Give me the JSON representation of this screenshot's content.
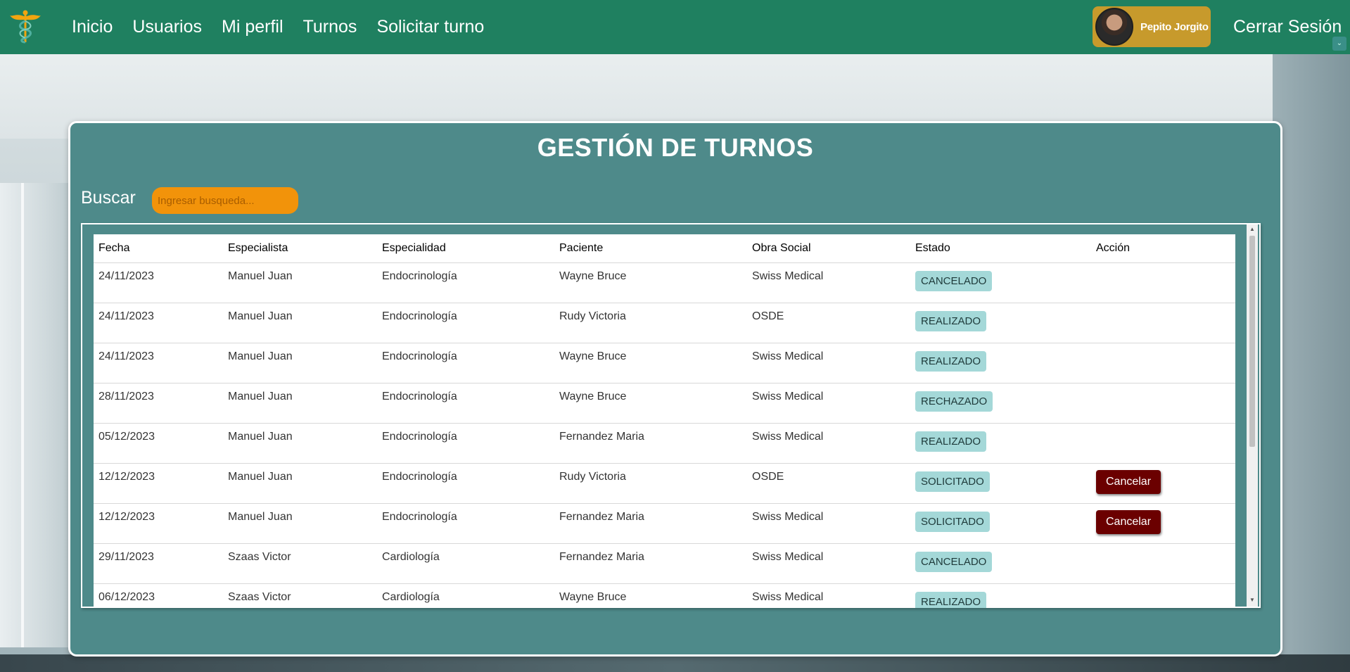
{
  "nav": {
    "links": [
      "Inicio",
      "Usuarios",
      "Mi perfil",
      "Turnos",
      "Solicitar turno"
    ],
    "user_name": "Pepito Jorgito",
    "logout_label": "Cerrar Sesión",
    "brand_color": "#1f8060"
  },
  "panel": {
    "title": "GESTIÓN DE TURNOS",
    "search_label": "Buscar",
    "search_placeholder": "Ingresar busqueda...",
    "search_value": ""
  },
  "table": {
    "headers": [
      "Fecha",
      "Especialista",
      "Especialidad",
      "Paciente",
      "Obra Social",
      "Estado",
      "Acción"
    ],
    "rows": [
      {
        "fecha": "24/11/2023",
        "especialista": "Manuel Juan",
        "especialidad": "Endocrinología",
        "paciente": "Wayne Bruce",
        "obra_social": "Swiss Medical",
        "estado": "CANCELADO",
        "accion": ""
      },
      {
        "fecha": "24/11/2023",
        "especialista": "Manuel Juan",
        "especialidad": "Endocrinología",
        "paciente": "Rudy Victoria",
        "obra_social": "OSDE",
        "estado": "REALIZADO",
        "accion": ""
      },
      {
        "fecha": "24/11/2023",
        "especialista": "Manuel Juan",
        "especialidad": "Endocrinología",
        "paciente": "Wayne Bruce",
        "obra_social": "Swiss Medical",
        "estado": "REALIZADO",
        "accion": ""
      },
      {
        "fecha": "28/11/2023",
        "especialista": "Manuel Juan",
        "especialidad": "Endocrinología",
        "paciente": "Wayne Bruce",
        "obra_social": "Swiss Medical",
        "estado": "RECHAZADO",
        "accion": ""
      },
      {
        "fecha": "05/12/2023",
        "especialista": "Manuel Juan",
        "especialidad": "Endocrinología",
        "paciente": "Fernandez Maria",
        "obra_social": "Swiss Medical",
        "estado": "REALIZADO",
        "accion": ""
      },
      {
        "fecha": "12/12/2023",
        "especialista": "Manuel Juan",
        "especialidad": "Endocrinología",
        "paciente": "Rudy Victoria",
        "obra_social": "OSDE",
        "estado": "SOLICITADO",
        "accion": "Cancelar"
      },
      {
        "fecha": "12/12/2023",
        "especialista": "Manuel Juan",
        "especialidad": "Endocrinología",
        "paciente": "Fernandez Maria",
        "obra_social": "Swiss Medical",
        "estado": "SOLICITADO",
        "accion": "Cancelar"
      },
      {
        "fecha": "29/11/2023",
        "especialista": "Szaas Victor",
        "especialidad": "Cardiología",
        "paciente": "Fernandez Maria",
        "obra_social": "Swiss Medical",
        "estado": "CANCELADO",
        "accion": ""
      },
      {
        "fecha": "06/12/2023",
        "especialista": "Szaas Victor",
        "especialidad": "Cardiología",
        "paciente": "Wayne Bruce",
        "obra_social": "Swiss Medical",
        "estado": "REALIZADO",
        "accion": ""
      }
    ]
  },
  "colors": {
    "panel": "#4e8a8a",
    "search_bg": "#f2930a",
    "badge_bg": "#a4d8d8",
    "cancel_bg": "#6b0000",
    "user_chip": "#c79a2c"
  }
}
